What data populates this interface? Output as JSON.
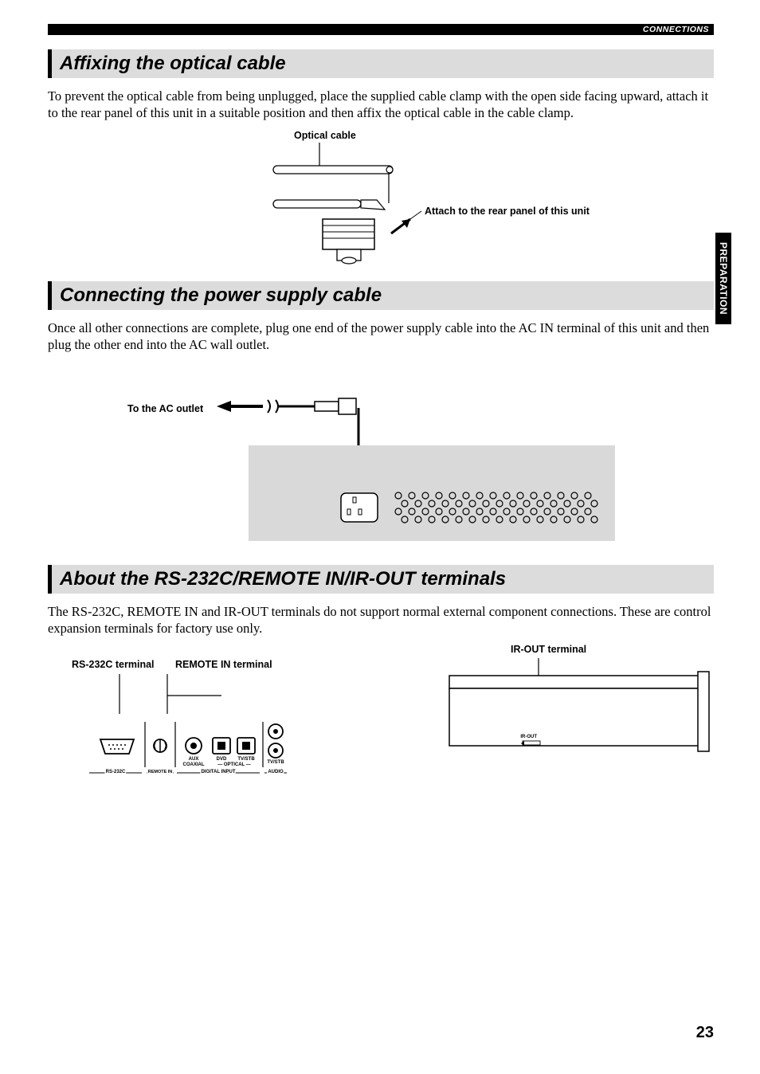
{
  "header": {
    "title": "CONNECTIONS"
  },
  "side_tab": "PREPARATION",
  "sections": {
    "optical": {
      "heading": "Affixing the optical cable",
      "body": "To prevent the optical cable from being unplugged, place the supplied cable clamp with the open side facing upward, attach it to the rear panel of this unit in a suitable position and then affix the optical cable in the cable clamp.",
      "fig": {
        "cable_label": "Optical cable",
        "attach_label": "Attach to the rear panel of this unit"
      }
    },
    "power": {
      "heading": "Connecting the power supply cable",
      "body": "Once all other connections are complete, plug one end of the power supply cable into the AC IN terminal of this unit and then plug the other end into the AC wall outlet.",
      "fig": {
        "ac_label": "To the AC outlet"
      }
    },
    "terminals": {
      "heading": "About the RS-232C/REMOTE IN/IR-OUT terminals",
      "body": "The RS-232C, REMOTE IN and IR-OUT terminals do not support normal external component connections. These are control expansion terminals for factory use only.",
      "fig": {
        "rs232_label": "RS-232C terminal",
        "remote_in_label": "REMOTE IN terminal",
        "ir_out_label": "IR-OUT terminal",
        "panel": {
          "aux": "AUX",
          "coaxial": "COAXIAL",
          "dvd": "DVD",
          "tvstb": "TV/STB",
          "optical": "OPTICAL",
          "tvstb2": "TV/STB",
          "audio": "AUDIO",
          "rs232c": "RS-232C",
          "remotein": "REMOTE IN",
          "digital_input": "DIGITAL INPUT",
          "irout_small": "IR-OUT"
        }
      }
    }
  },
  "page_number": "23"
}
